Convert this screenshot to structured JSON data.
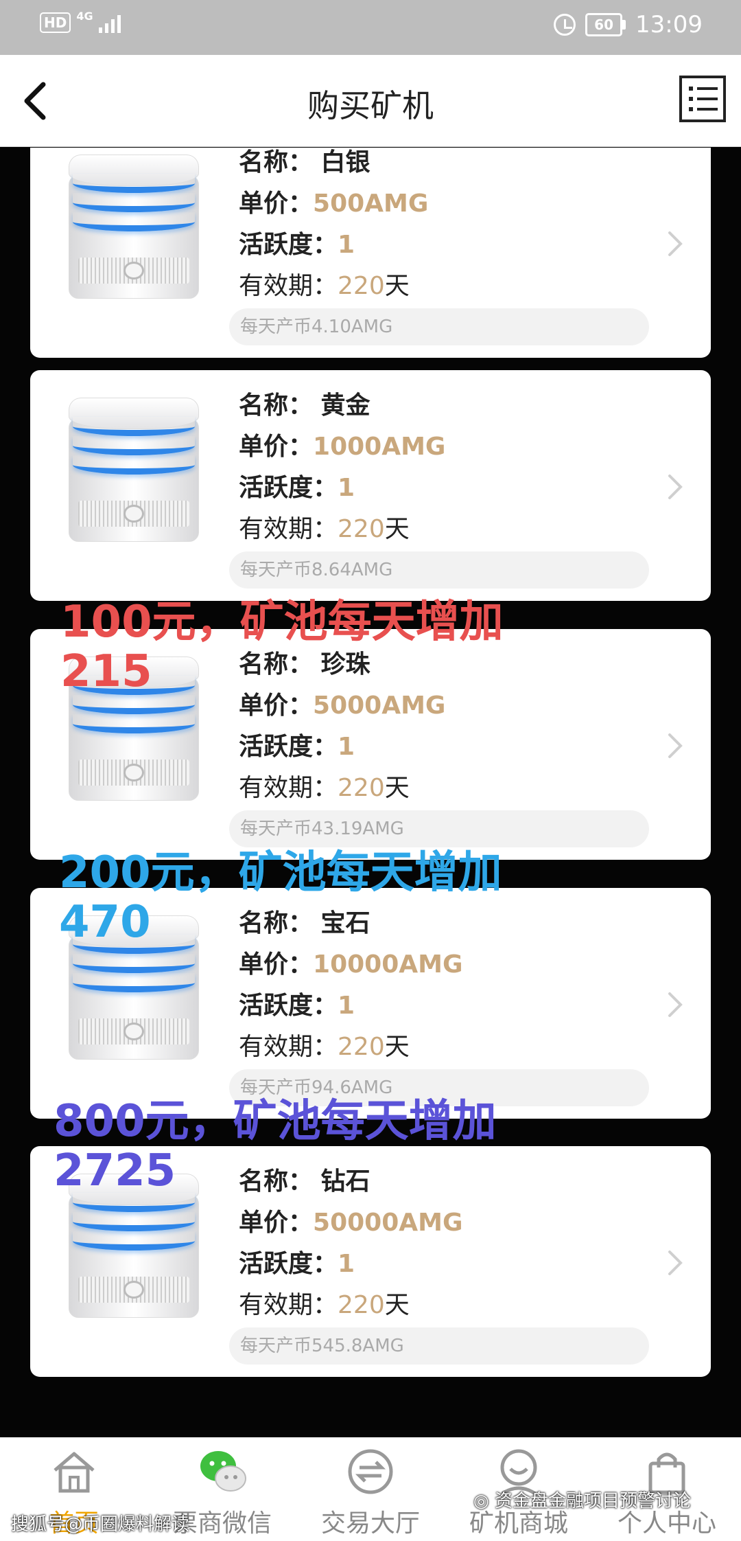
{
  "status_bar": {
    "hd": "HD",
    "network": "4G",
    "battery": "60",
    "time": "13:09"
  },
  "header": {
    "title": "购买矿机"
  },
  "cards": [
    {
      "name_label": "名称：",
      "name": "白银",
      "price_label": "单价：",
      "price": "500AMG",
      "activity_label": "活跃度：",
      "activity": "1",
      "validity_label": "有效期：",
      "validity_num": "220",
      "validity_unit": "天",
      "daily": "每天产币4.10AMG"
    },
    {
      "name_label": "名称：",
      "name": "黄金",
      "price_label": "单价：",
      "price": "1000AMG",
      "activity_label": "活跃度：",
      "activity": "1",
      "validity_label": "有效期：",
      "validity_num": "220",
      "validity_unit": "天",
      "daily": "每天产币8.64AMG"
    },
    {
      "name_label": "名称：",
      "name": "珍珠",
      "price_label": "单价：",
      "price": "5000AMG",
      "activity_label": "活跃度：",
      "activity": "1",
      "validity_label": "有效期：",
      "validity_num": "220",
      "validity_unit": "天",
      "daily": "每天产币43.19AMG"
    },
    {
      "name_label": "名称：",
      "name": "宝石",
      "price_label": "单价：",
      "price": "10000AMG",
      "activity_label": "活跃度：",
      "activity": "1",
      "validity_label": "有效期：",
      "validity_num": "220",
      "validity_unit": "天",
      "daily": "每天产币94.6AMG"
    },
    {
      "name_label": "名称：",
      "name": "钻石",
      "price_label": "单价：",
      "price": "50000AMG",
      "activity_label": "活跃度：",
      "activity": "1",
      "validity_label": "有效期：",
      "validity_num": "220",
      "validity_unit": "天",
      "daily": "每天产币545.8AMG"
    }
  ],
  "annotations": [
    {
      "line1": "100元，矿池每天增加",
      "line2": "215",
      "color": "#e8504f"
    },
    {
      "line1": "200元，矿池每天增加",
      "line2": "470",
      "color": "#2ea7e8"
    },
    {
      "line1": "800元，矿池每天增加",
      "line2": "2725",
      "color": "#5b53d8"
    }
  ],
  "tabs": [
    {
      "label": "首页",
      "icon": "home-icon",
      "active": true
    },
    {
      "label": "票商微信",
      "icon": "wechat-icon"
    },
    {
      "label": "交易大厅",
      "icon": "exchange-icon"
    },
    {
      "label": "矿机商城",
      "icon": "smiley-icon"
    },
    {
      "label": "个人中心",
      "icon": "bag-icon"
    }
  ],
  "watermarks": {
    "left": "搜狐号@币圈爆料解读",
    "right": "资金盘金融项目预警讨论"
  },
  "colors": {
    "accent_gold": "#c9a77c",
    "tab_active": "#f0a500",
    "status_bar": "#bdbdbd"
  }
}
